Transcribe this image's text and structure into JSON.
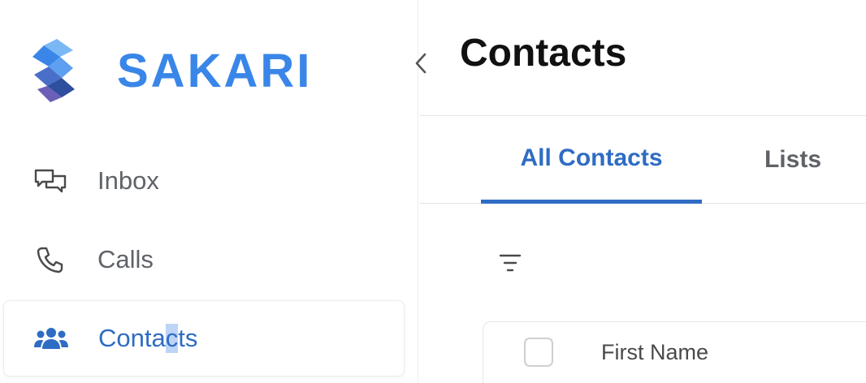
{
  "app": {
    "brand_name": "SAKARI",
    "brand_color": "#3a86e8",
    "accent_color": "#2f6cc4"
  },
  "sidebar": {
    "collapse_icon": "chevron-left-icon",
    "items": [
      {
        "label": "Inbox",
        "icon": "chat-bubbles-icon",
        "active": false
      },
      {
        "label": "Calls",
        "icon": "phone-icon",
        "active": false
      },
      {
        "label_before_cursor": "Conta",
        "label_cursor": "c",
        "label_after_cursor": "ts",
        "icon": "users-icon",
        "active": true
      }
    ]
  },
  "main": {
    "title": "Contacts",
    "tabs": [
      {
        "label": "All Contacts",
        "active": true
      },
      {
        "label": "Lists",
        "active": false
      }
    ],
    "filter_icon": "filter-icon",
    "table": {
      "columns": [
        "First Name"
      ]
    }
  }
}
